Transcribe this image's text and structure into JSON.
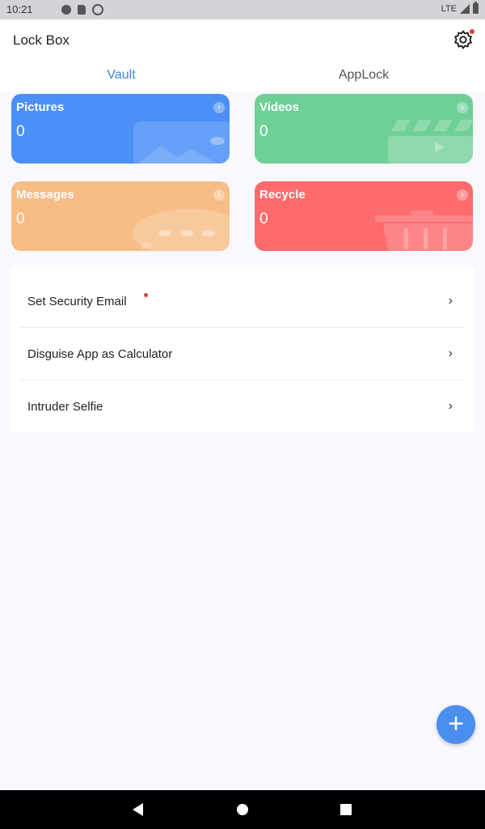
{
  "status_bar": {
    "time": "10:21",
    "network": "LTE"
  },
  "app_bar": {
    "title": "Lock Box",
    "settings_icon": "gear-icon"
  },
  "tabs": [
    {
      "label": "Vault",
      "active": true
    },
    {
      "label": "AppLock",
      "active": false
    }
  ],
  "cards": [
    {
      "title": "Pictures",
      "count": "0",
      "color": "#4b8ff7"
    },
    {
      "title": "Videos",
      "count": "0",
      "color": "#6fd097"
    },
    {
      "title": "Messages",
      "count": "0",
      "color": "#f8bc86"
    },
    {
      "title": "Recycle",
      "count": "0",
      "color": "#fe6b6d"
    }
  ],
  "menu": [
    {
      "label": "Set Security Email",
      "has_badge": true
    },
    {
      "label": "Disguise App as Calculator",
      "has_badge": false
    },
    {
      "label": "Intruder Selfie",
      "has_badge": false
    }
  ],
  "fab": {
    "icon": "plus-icon",
    "symbol": "+"
  },
  "colors": {
    "accent": "#3d86d9",
    "fab": "#4a8eef",
    "badge": "#e53935"
  }
}
